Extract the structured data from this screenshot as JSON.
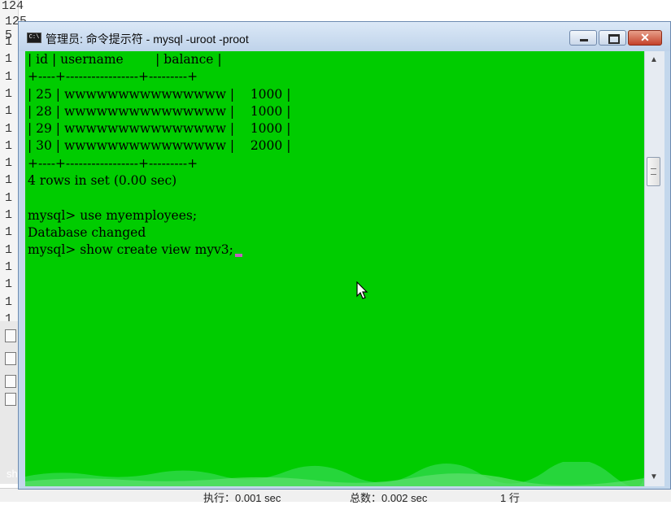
{
  "background_editor": {
    "top_line_number": "124",
    "partial_line": "125   5 /",
    "gutter_numbers": [
      "1",
      "1",
      "1",
      "1",
      "1",
      "1",
      "1",
      "1",
      "1",
      "1",
      "1",
      "1",
      "1",
      "1",
      "1",
      "1",
      "1"
    ],
    "side_tab_label": "sh",
    "status": {
      "exec_time": "执行：0.001 sec",
      "total_time": "总数：0.002 sec",
      "rows": "1 行"
    }
  },
  "window": {
    "title": "管理员: 命令提示符 - mysql  -uroot -proot",
    "title_icon": "C:\\",
    "close_glyph": "✕"
  },
  "console": {
    "lines": [
      "| id | username        | balance |",
      "+----+-----------------+---------+",
      "| 25 | wwwwwwwwwwwwwww |    1000 |",
      "| 28 | wwwwwwwwwwwwwww |    1000 |",
      "| 29 | wwwwwwwwwwwwwww |    1000 |",
      "| 30 | wwwwwwwwwwwwwww |    2000 |",
      "+----+-----------------+---------+",
      "4 rows in set (0.00 sec)",
      "",
      "mysql> use myemployees;",
      "Database changed",
      "mysql> show create view myv3;"
    ]
  },
  "colors": {
    "console_bg": "#00cc00",
    "console_text": "#000000",
    "titlebar": "#c3d7ec"
  }
}
